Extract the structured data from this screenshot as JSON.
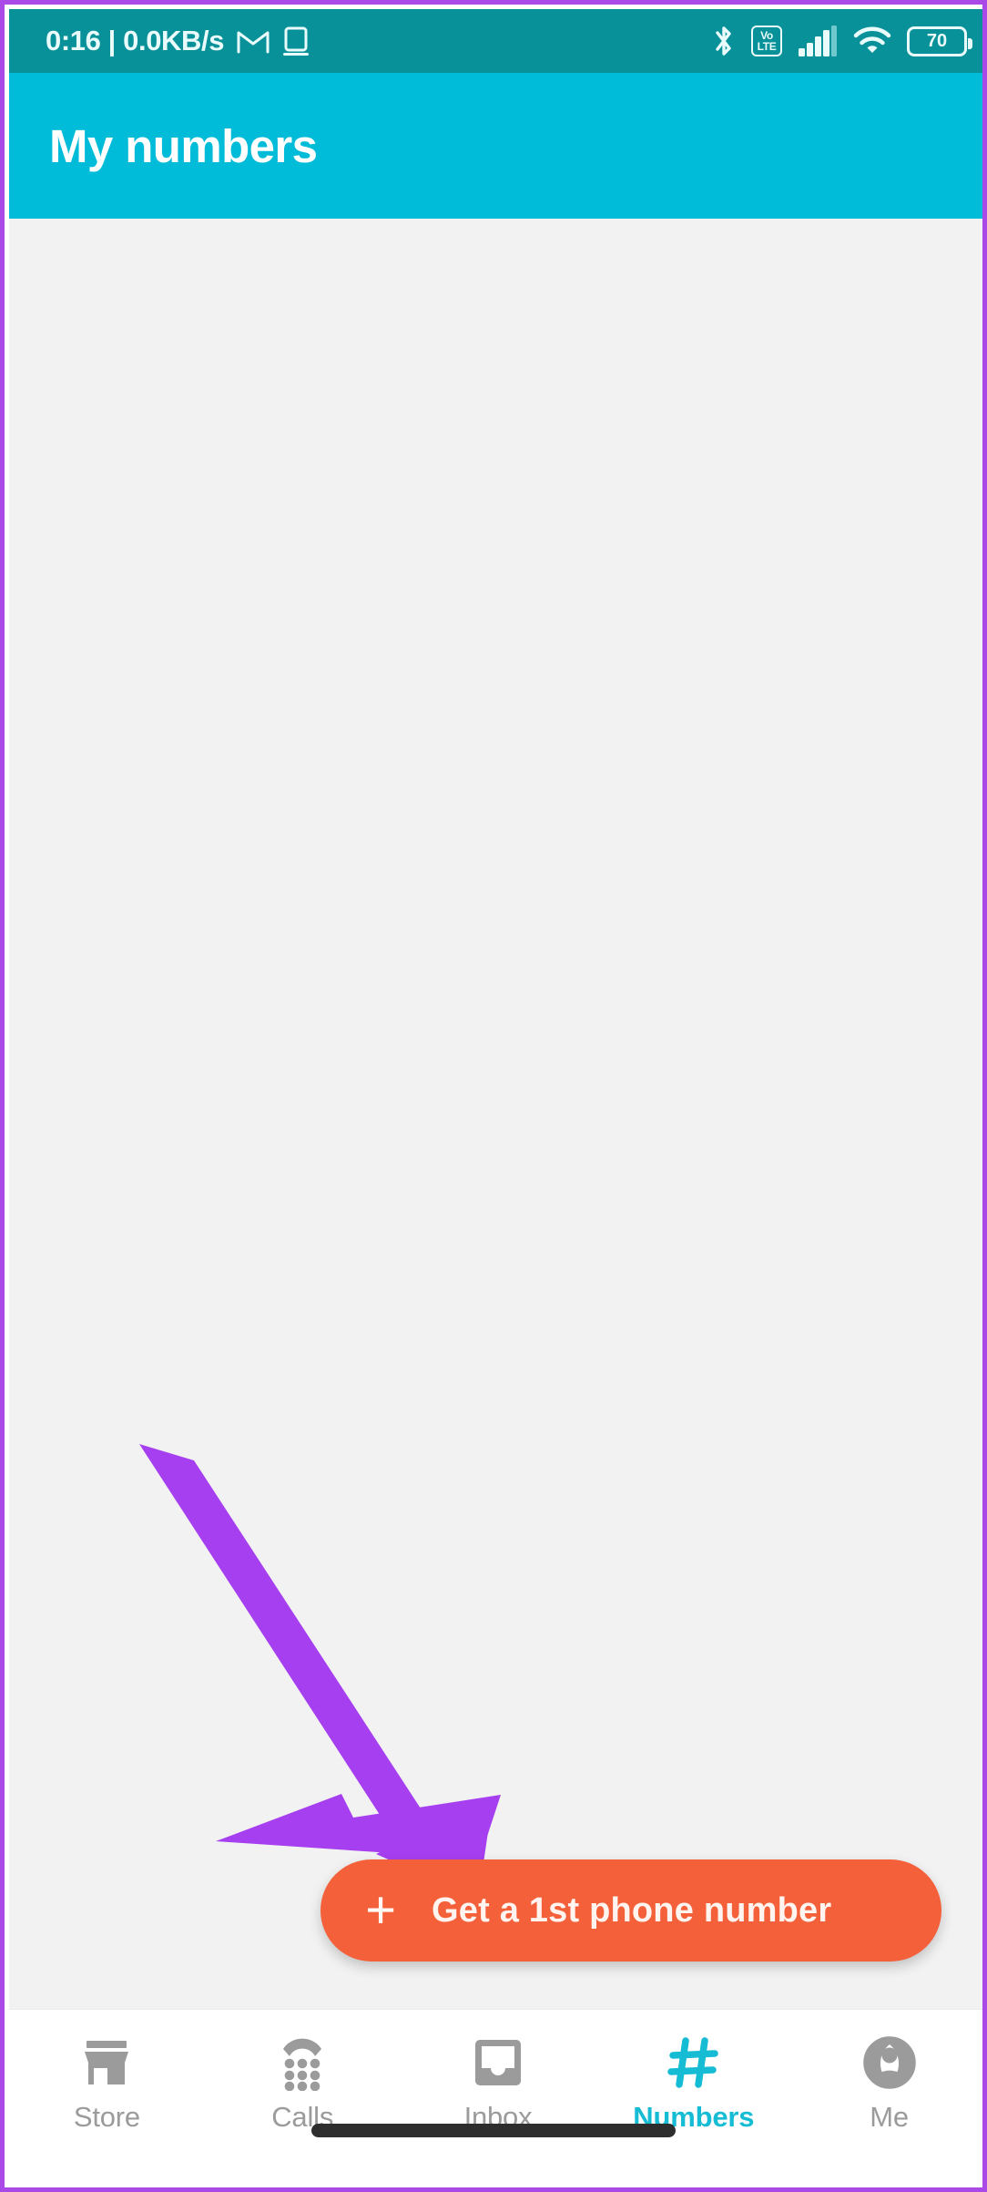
{
  "frame": {
    "accent_color": "#a94ae8"
  },
  "status_bar": {
    "background": "#089199",
    "time_and_speed": "0:16 | 0.0KB/s",
    "left_icons": [
      "gmail-icon",
      "cast-screen-icon"
    ],
    "right_icons": [
      "bluetooth-icon",
      "volte-icon",
      "signal-icon",
      "wifi-icon",
      "battery-icon"
    ],
    "volte_top": "Vo",
    "volte_bottom": "LTE",
    "battery_level": "70"
  },
  "app_bar": {
    "title": "My numbers",
    "background": "#00bcd9"
  },
  "content": {
    "background": "#f2f2f2",
    "empty": true
  },
  "cta": {
    "plus_icon": "plus-icon",
    "label": "Get a 1st phone number",
    "background": "#f4603a",
    "text_color": "#fff4ef"
  },
  "annotation": {
    "type": "arrow",
    "color": "#a63ff0",
    "points_to": "cta-button"
  },
  "bottom_nav": {
    "active_color": "#16bcd4",
    "inactive_color": "#9b9b9b",
    "items": [
      {
        "label": "Store",
        "icon": "storefront-icon",
        "active": false
      },
      {
        "label": "Calls",
        "icon": "dialpad-phone-icon",
        "active": false
      },
      {
        "label": "Inbox",
        "icon": "inbox-tray-icon",
        "active": false
      },
      {
        "label": "Numbers",
        "icon": "hash-icon",
        "active": true
      },
      {
        "label": "Me",
        "icon": "account-circle-icon",
        "active": false
      }
    ]
  },
  "home_indicator": {
    "name": "gesture-home-bar"
  }
}
